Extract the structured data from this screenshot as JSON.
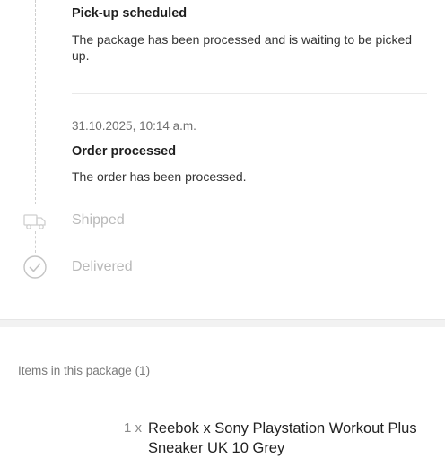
{
  "timeline": {
    "pickup": {
      "title": "Pick-up scheduled",
      "description": "The package has been processed and is waiting to be picked up."
    },
    "processed": {
      "date": "31.10.2025, 10:14 a.m.",
      "title": "Order processed",
      "description": "The order has been processed."
    },
    "shipped": {
      "label": "Shipped",
      "icon": "truck-icon"
    },
    "delivered": {
      "label": "Delivered",
      "icon": "check-circle-icon"
    }
  },
  "package": {
    "heading": "Items in this package (1)",
    "items": [
      {
        "qty": "1 x",
        "name": "Reebok x Sony Playstation Workout Plus Sneaker UK 10 Grey"
      }
    ]
  },
  "colors": {
    "inactive": "#b9b9b9",
    "separator": "#f2f2f2"
  }
}
